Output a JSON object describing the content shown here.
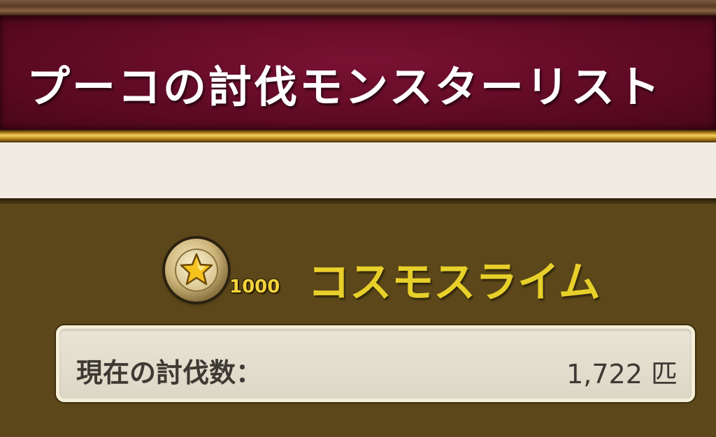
{
  "header": {
    "title": "プーコの討伐モンスターリスト"
  },
  "monster": {
    "medal_icon": "star-medal-icon",
    "medal_count": "1000",
    "name": "コスモスライム"
  },
  "kill_count": {
    "label": "現在の討伐数：",
    "value": "1,722 匹"
  },
  "colors": {
    "header_bg": "#5e0a24",
    "panel_bg": "#5b4719",
    "monster_name": "#e8d02a",
    "medal_count": "#f2d33a"
  }
}
